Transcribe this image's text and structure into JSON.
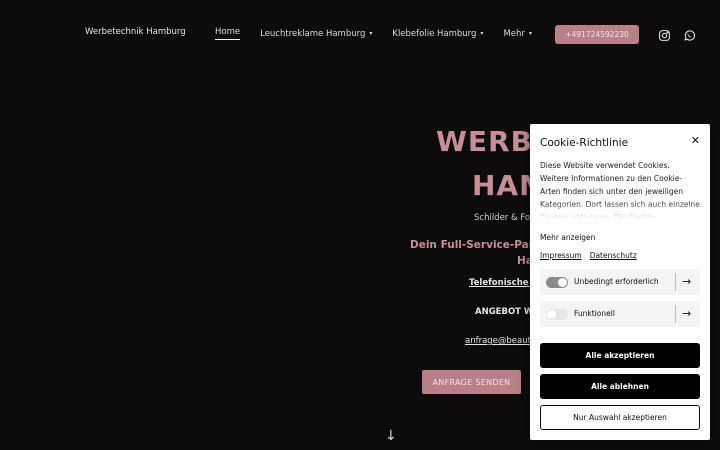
{
  "nav": {
    "brand": "Werbetechnik Hamburg",
    "items": [
      {
        "label": "Home",
        "active": true,
        "caret": ""
      },
      {
        "label": "Leuchtreklame Hamburg",
        "active": false,
        "caret": "▾"
      },
      {
        "label": "Klebefolie Hamburg",
        "active": false,
        "caret": "▾"
      },
      {
        "label": "Mehr",
        "active": false,
        "caret": "▾"
      }
    ],
    "phone": "+491724592230",
    "social_icons": [
      "instagram-icon",
      "whatsapp-icon"
    ]
  },
  "hero": {
    "title_line1": "WERBE",
    "title_line2": "HAM",
    "subtitle": "Schilder & Foli",
    "lead_line1": "Dein Full-Service-Partner",
    "lead_line2": "Ha",
    "phone_link": "Telefonische Be",
    "angebot": "ANGEBOT WE",
    "email": "anfrage@beauty",
    "cta": "ANFRAGE SENDEN",
    "scroll_arrow": "↓"
  },
  "cookie": {
    "title": "Cookie-Richtlinie",
    "close": "✕",
    "description": "Diese Website verwendet Cookies. Weitere Informationen zu den Cookie-Arten finden sich unter den jeweiligen Kategorien. Dort lassen sich auch einzelne Cookies aktivieren. Die Cookie-Einstellungen können jederzeit",
    "more": "Mehr anzeigen",
    "links": [
      "Impressum",
      "Datenschutz"
    ],
    "categories": [
      {
        "label": "Unbedingt erforderlich",
        "enabled": true
      },
      {
        "label": "Funktionell",
        "enabled": false
      }
    ],
    "accept_all": "Alle akzeptieren",
    "reject_all": "Alle ablehnen",
    "accept_selection": "Nur Auswahl akzeptieren"
  },
  "colors": {
    "accent": "#b98089",
    "accent_text": "#c88e97",
    "background": "#0d0b0c",
    "toggle_on": "#8a8a8a",
    "toggle_off": "#e6e6e6"
  }
}
